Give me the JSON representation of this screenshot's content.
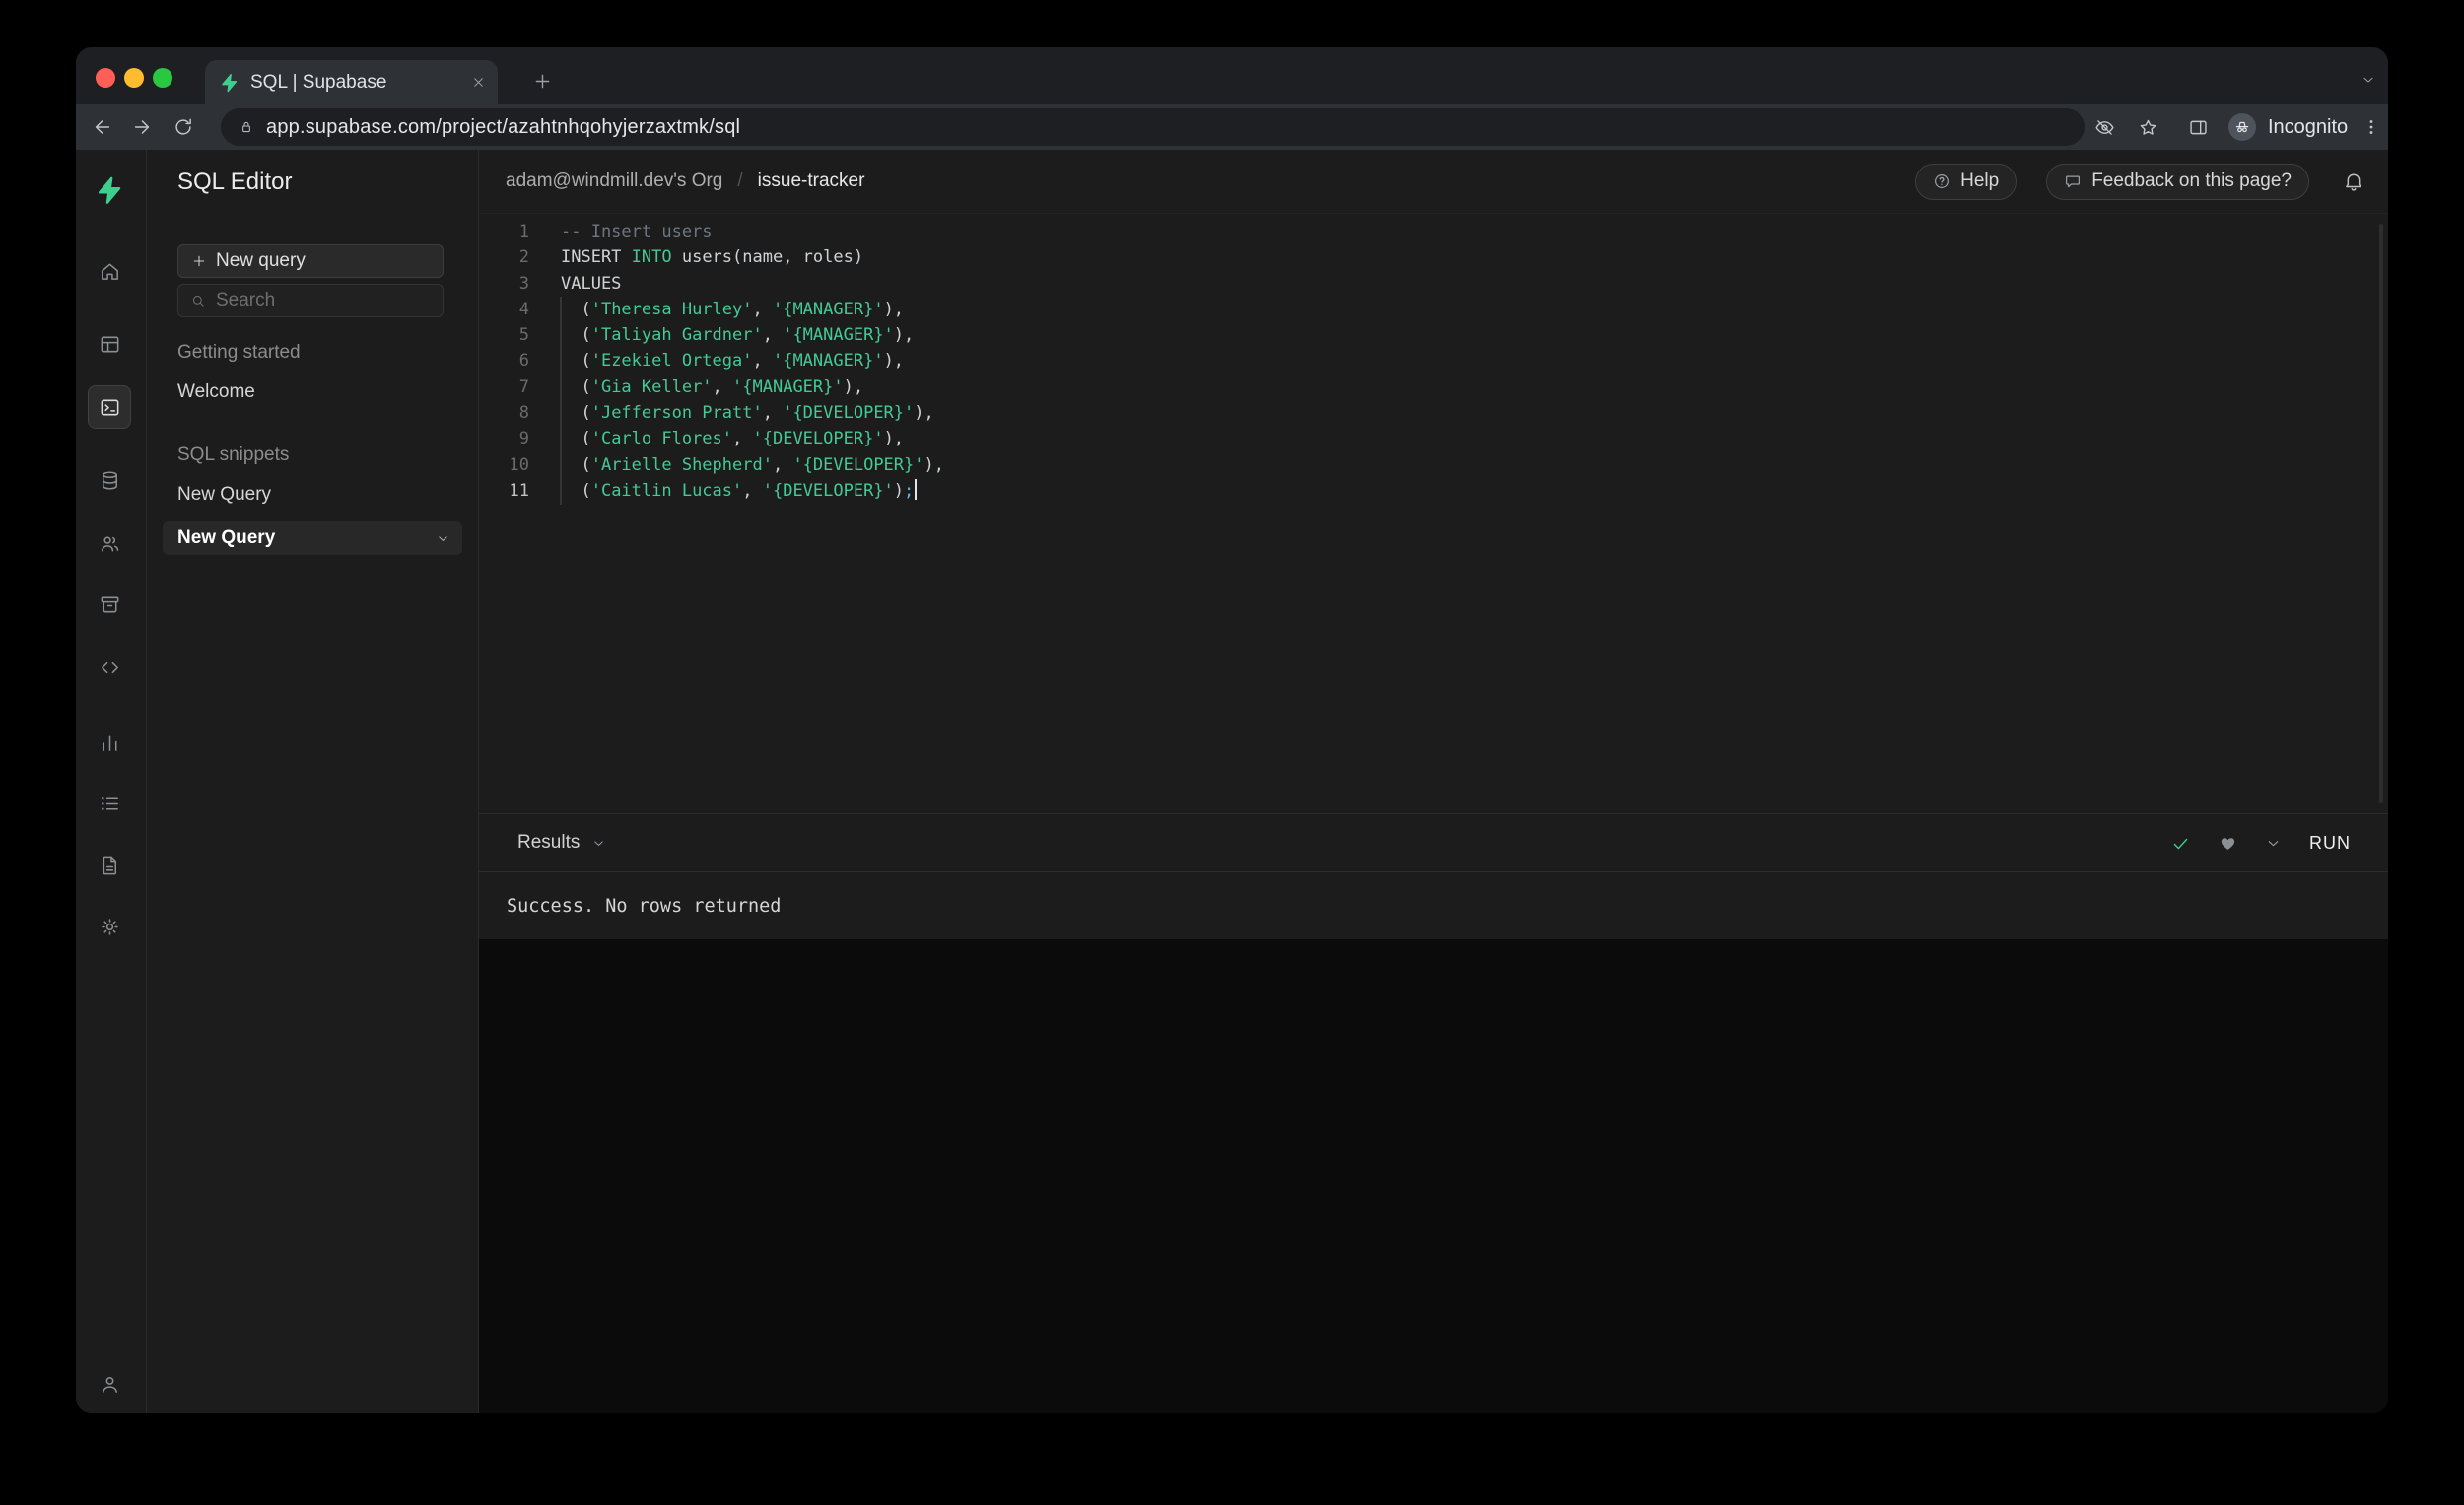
{
  "browser": {
    "tab_title": "SQL | Supabase",
    "url": "app.supabase.com/project/azahtnhqohyjerzaxtmk/sql",
    "incognito_label": "Incognito"
  },
  "rail": {
    "items": [
      {
        "name": "home"
      },
      {
        "name": "table-editor"
      },
      {
        "name": "sql-editor",
        "selected": true
      },
      {
        "name": "database"
      },
      {
        "name": "auth"
      },
      {
        "name": "storage"
      },
      {
        "name": "edge-functions"
      },
      {
        "name": "reports"
      },
      {
        "name": "logs"
      },
      {
        "name": "docs"
      },
      {
        "name": "settings"
      }
    ],
    "bottom_items": [
      {
        "name": "account"
      }
    ]
  },
  "sidebar": {
    "title": "SQL Editor",
    "new_query_label": "New query",
    "search_placeholder": "Search",
    "sections": [
      {
        "label": "Getting started",
        "items": [
          {
            "label": "Welcome",
            "selected": false
          }
        ]
      },
      {
        "label": "SQL snippets",
        "items": [
          {
            "label": "New Query",
            "selected": false
          },
          {
            "label": "New Query",
            "selected": true,
            "chevron": true
          }
        ]
      }
    ]
  },
  "header": {
    "org": "adam@windmill.dev's Org",
    "separator": "/",
    "project": "issue-tracker",
    "help_label": "Help",
    "feedback_label": "Feedback on this page?"
  },
  "editor": {
    "lines": [
      {
        "tokens": [
          [
            "comment",
            "-- Insert users"
          ]
        ]
      },
      {
        "tokens": [
          [
            "plain",
            "INSERT "
          ],
          [
            "keyword",
            "INTO"
          ],
          [
            "plain",
            " users(name, roles)"
          ]
        ]
      },
      {
        "tokens": [
          [
            "plain",
            "VALUES"
          ]
        ]
      },
      {
        "tokens": [
          [
            "plain",
            "  ("
          ],
          [
            "string",
            "'Theresa Hurley'"
          ],
          [
            "plain",
            ", "
          ],
          [
            "string",
            "'{MANAGER}'"
          ],
          [
            "plain",
            "),"
          ]
        ]
      },
      {
        "tokens": [
          [
            "plain",
            "  ("
          ],
          [
            "string",
            "'Taliyah Gardner'"
          ],
          [
            "plain",
            ", "
          ],
          [
            "string",
            "'{MANAGER}'"
          ],
          [
            "plain",
            "),"
          ]
        ]
      },
      {
        "tokens": [
          [
            "plain",
            "  ("
          ],
          [
            "string",
            "'Ezekiel Ortega'"
          ],
          [
            "plain",
            ", "
          ],
          [
            "string",
            "'{MANAGER}'"
          ],
          [
            "plain",
            "),"
          ]
        ]
      },
      {
        "tokens": [
          [
            "plain",
            "  ("
          ],
          [
            "string",
            "'Gia Keller'"
          ],
          [
            "plain",
            ", "
          ],
          [
            "string",
            "'{MANAGER}'"
          ],
          [
            "plain",
            "),"
          ]
        ]
      },
      {
        "tokens": [
          [
            "plain",
            "  ("
          ],
          [
            "string",
            "'Jefferson Pratt'"
          ],
          [
            "plain",
            ", "
          ],
          [
            "string",
            "'{DEVELOPER}'"
          ],
          [
            "plain",
            "),"
          ]
        ]
      },
      {
        "tokens": [
          [
            "plain",
            "  ("
          ],
          [
            "string",
            "'Carlo Flores'"
          ],
          [
            "plain",
            ", "
          ],
          [
            "string",
            "'{DEVELOPER}'"
          ],
          [
            "plain",
            "),"
          ]
        ]
      },
      {
        "tokens": [
          [
            "plain",
            "  ("
          ],
          [
            "string",
            "'Arielle Shepherd'"
          ],
          [
            "plain",
            ", "
          ],
          [
            "string",
            "'{DEVELOPER}'"
          ],
          [
            "plain",
            "),"
          ]
        ]
      },
      {
        "tokens": [
          [
            "plain",
            "  ("
          ],
          [
            "string",
            "'Caitlin Lucas'"
          ],
          [
            "plain",
            ", "
          ],
          [
            "string",
            "'{DEVELOPER}'"
          ],
          [
            "plain",
            ")"
          ],
          [
            "semi",
            ";"
          ]
        ],
        "cursor": true
      }
    ]
  },
  "results": {
    "label": "Results",
    "run_label": "RUN",
    "message": "Success. No rows returned"
  },
  "colors": {
    "accent_green": "#3ecf8e",
    "syntax_keyword": "#44c998",
    "syntax_string": "#44c998",
    "syntax_comment": "#6e7681",
    "syntax_plain": "#d0d3d6",
    "syntax_semicolon": "#5cb8d6",
    "success_check": "#3ecf8e"
  }
}
